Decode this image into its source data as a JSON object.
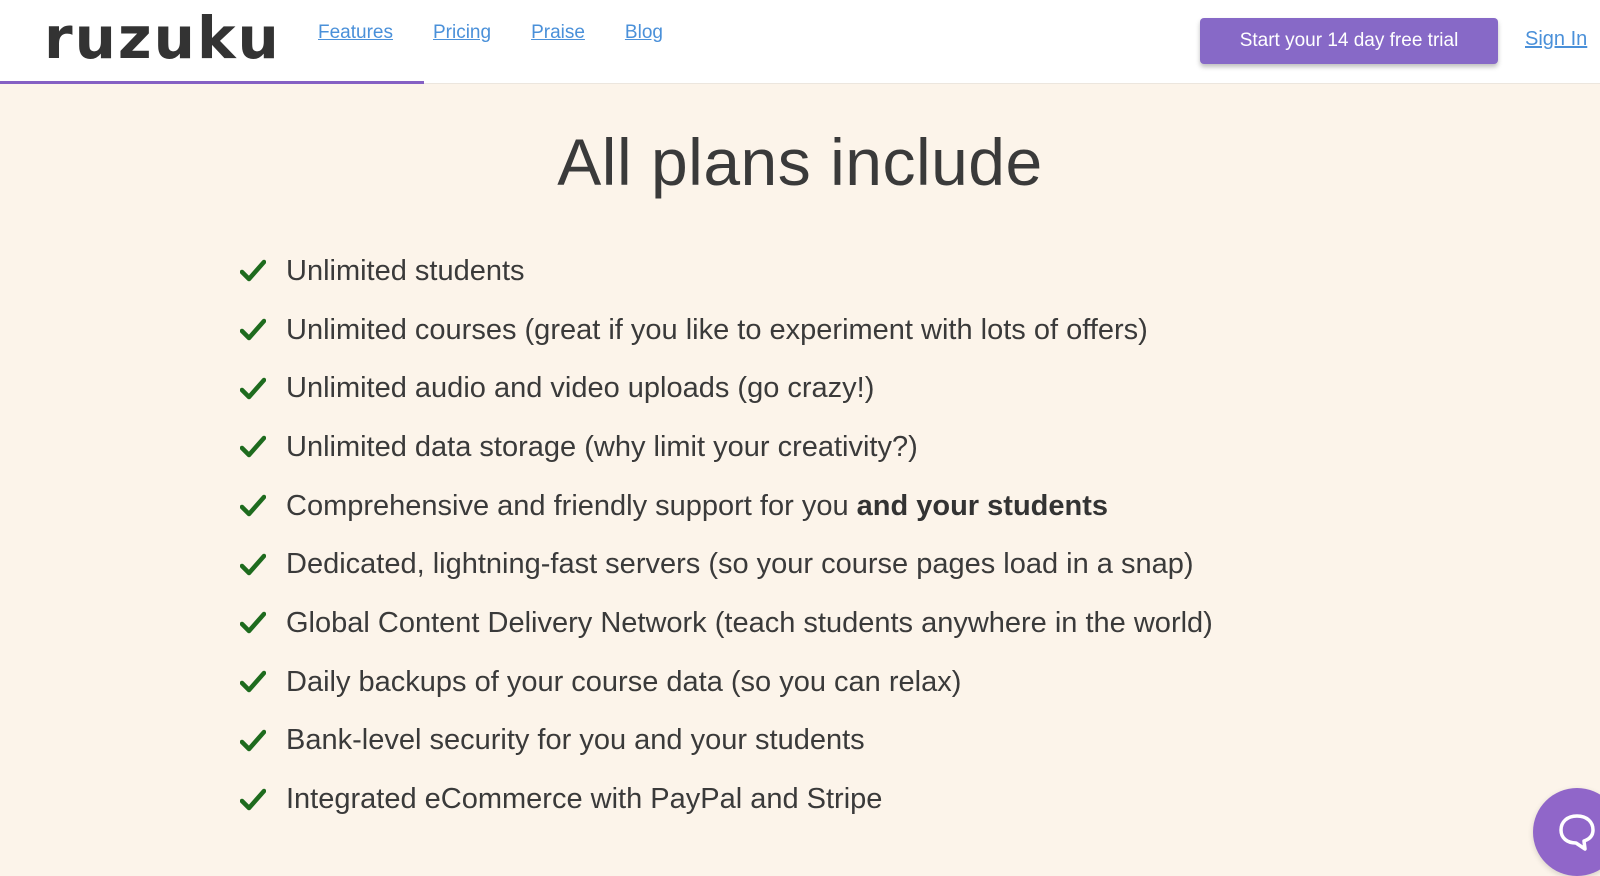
{
  "header": {
    "logo": "ruzuku",
    "nav": [
      "Features",
      "Pricing",
      "Praise",
      "Blog"
    ],
    "cta_label": "Start your 14 day free trial",
    "signin_label": "Sign In",
    "accent_color": "#8769c7",
    "link_color": "#4a90d9"
  },
  "main": {
    "title": "All plans include",
    "check_color": "#1e6b1e",
    "features": [
      {
        "text": "Unlimited students",
        "bold": ""
      },
      {
        "text": "Unlimited courses (great if you like to experiment with lots of offers)",
        "bold": ""
      },
      {
        "text": "Unlimited audio and video uploads (go crazy!)",
        "bold": ""
      },
      {
        "text": "Unlimited data storage (why limit your creativity?)",
        "bold": ""
      },
      {
        "text": "Comprehensive and friendly support for you ",
        "bold": "and your students"
      },
      {
        "text": "Dedicated, lightning-fast servers (so your course pages load in a snap)",
        "bold": ""
      },
      {
        "text": "Global Content Delivery Network (teach students anywhere in the world)",
        "bold": ""
      },
      {
        "text": "Daily backups of your course data (so you can relax)",
        "bold": ""
      },
      {
        "text": "Bank-level security for you and your students",
        "bold": ""
      },
      {
        "text": "Integrated eCommerce with PayPal and Stripe",
        "bold": ""
      }
    ]
  },
  "chat_widget": {
    "icon": "chat-bubble-icon"
  }
}
